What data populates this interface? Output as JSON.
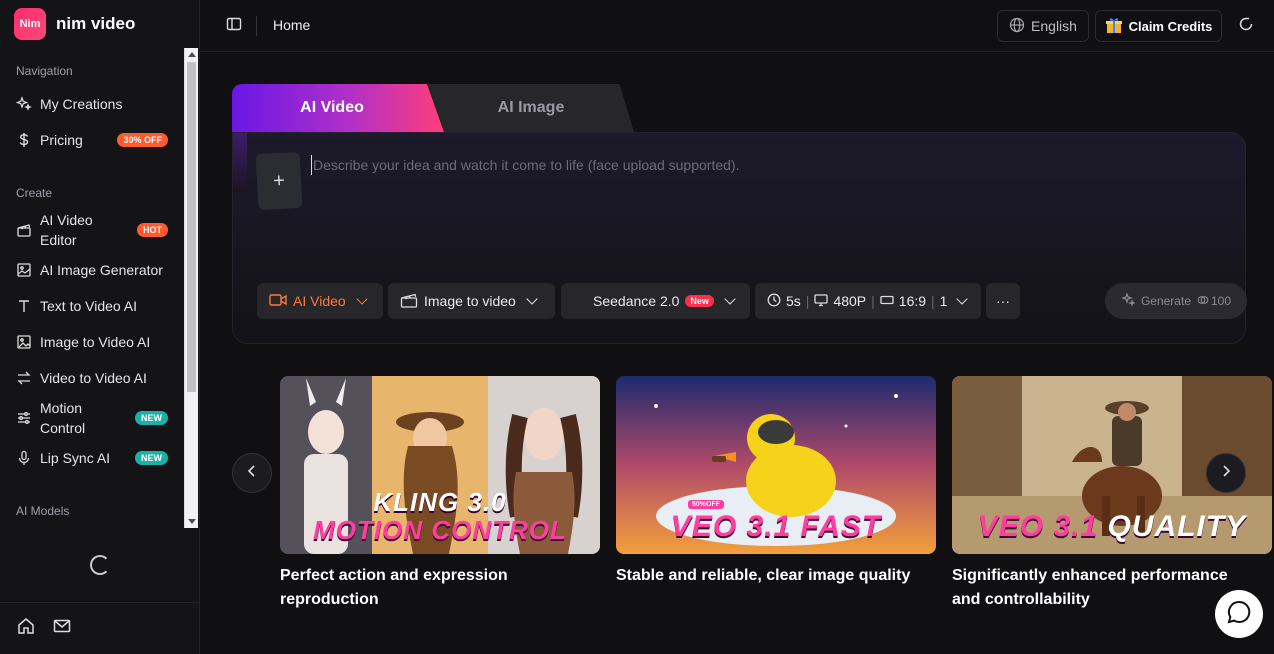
{
  "brand": {
    "logo_text": "Nim",
    "name": "nim video"
  },
  "sidebar": {
    "sections": {
      "navigation": "Navigation",
      "create": "Create",
      "ai_models": "AI Models"
    },
    "nav_items": [
      {
        "label": "My Creations",
        "icon": "sparkles-icon"
      },
      {
        "label": "Pricing",
        "icon": "dollar-icon",
        "badge": "30% OFF"
      }
    ],
    "create_items": [
      {
        "label": "AI Video Editor",
        "icon": "clapperboard-icon",
        "badge": "HOT"
      },
      {
        "label": "AI Image Generator",
        "icon": "image-edit-icon"
      },
      {
        "label": "Text to Video AI",
        "icon": "text-icon"
      },
      {
        "label": "Image to Video AI",
        "icon": "image-icon"
      },
      {
        "label": "Video to Video AI",
        "icon": "swap-icon"
      },
      {
        "label": "Motion Control",
        "icon": "sliders-icon",
        "badge": "NEW"
      },
      {
        "label": "Lip Sync AI",
        "icon": "microphone-icon",
        "badge": "NEW"
      }
    ]
  },
  "topbar": {
    "breadcrumb": "Home",
    "language": "English",
    "claim_credits": "Claim Credits"
  },
  "composer": {
    "tabs": [
      "AI Video",
      "AI Image"
    ],
    "active_tab": "AI Video",
    "upload_symbol": "+",
    "prompt_placeholder": "Describe your idea and watch it come to life (face upload supported).",
    "prompt_value": "",
    "controls": {
      "mode": "AI Video",
      "input_type": "Image to video",
      "model": "Seedance 2.0",
      "model_tag": "New",
      "duration": "5s",
      "resolution": "480P",
      "aspect_ratio": "16:9",
      "count": "1",
      "more": "···"
    },
    "generate": {
      "label": "Generate",
      "cost": "100"
    }
  },
  "carousel": {
    "cards": [
      {
        "title": "Perfect action and expression reproduction",
        "overlay_white": "KLING 3.0",
        "overlay_pink": "MOTION CONTROL"
      },
      {
        "title": "Stable and reliable, clear image quality",
        "overlay_white": "",
        "overlay_pink": "VEO 3.1 FAST",
        "tag": "50%OFF"
      },
      {
        "title": "Significantly enhanced performance and controllability",
        "overlay_white": "QUALITY",
        "overlay_pink": "VEO 3.1"
      }
    ]
  },
  "colors": {
    "accent_pink": "#ff3e7a",
    "accent_purple": "#6a17e6",
    "accent_orange": "#ff7a3d",
    "badge_new": "#18b3a8"
  }
}
